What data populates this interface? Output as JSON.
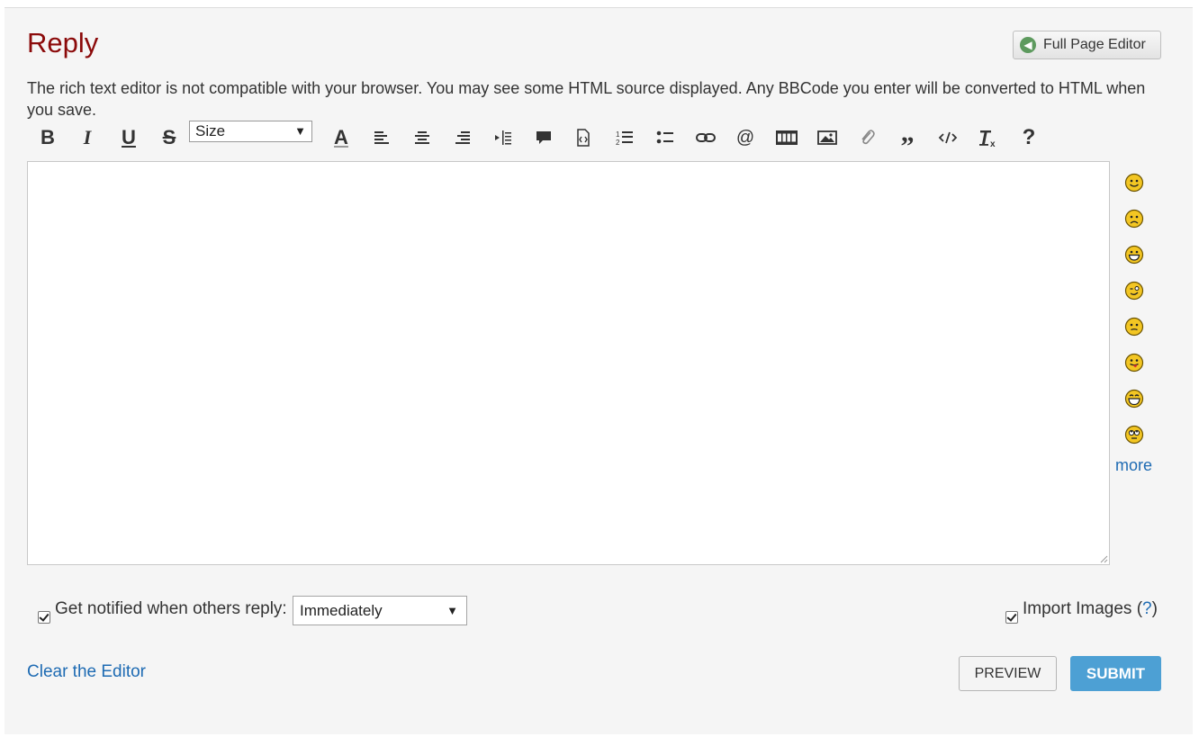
{
  "page": {
    "title": "Reply"
  },
  "header": {
    "full_page_editor_label": "Full Page Editor"
  },
  "notice": "The rich text editor is not compatible with your browser. You may see some HTML source displayed. Any BBCode you enter will be converted to HTML when you save.",
  "toolbar": {
    "bold_label": "B",
    "italic_label": "I",
    "underline_label": "U",
    "strike_label": "S",
    "size_select_value": "Size",
    "font_color_label": "A",
    "help_label": "?"
  },
  "smileys": {
    "more_label": "more",
    "icons": [
      "smile-icon",
      "sad-icon",
      "grin-icon",
      "wink-icon",
      "confused-icon",
      "tongue-icon",
      "laugh-icon",
      "rolleyes-icon"
    ]
  },
  "options": {
    "notify_label": "Get notified when others reply:",
    "notify_value": "Immediately",
    "notify_checked": true,
    "import_images_label": "Import Images (",
    "import_images_help": "?",
    "import_images_close": ")",
    "import_images_checked": true
  },
  "actions": {
    "clear_label": "Clear the Editor",
    "preview_label": "PREVIEW",
    "submit_label": "SUBMIT"
  },
  "colors": {
    "title": "#8b0a0a",
    "link": "#1e6bb3",
    "submit": "#4da0d4",
    "smiley_fill": "#f3c623"
  }
}
